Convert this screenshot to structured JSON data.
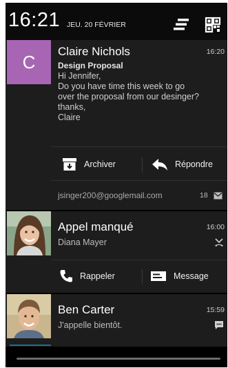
{
  "status_bar": {
    "time": "16:21",
    "date": "JEU. 20 FÉVRIER",
    "icons": [
      "notification-settings-icon",
      "quick-settings-icon"
    ]
  },
  "email_notification": {
    "avatar_letter": "C",
    "avatar_color": "#a865b4",
    "sender": "Claire Nichols",
    "time": "16:20",
    "subject": "Design Proposal",
    "body_lines": [
      "Hi Jennifer,",
      "Do you have time this week to go",
      "over the proposal from our desinger?",
      "thanks,",
      "Claire"
    ],
    "actions": [
      {
        "label": "Archiver",
        "icon": "archive-icon"
      },
      {
        "label": "Répondre",
        "icon": "reply-icon"
      }
    ],
    "account": "jsinger200@googlemail.com",
    "unread_count": "18",
    "account_icon": "mail-icon"
  },
  "missed_call_notification": {
    "avatar": "photo-woman",
    "title": "Appel manqué",
    "caller": "Diana Mayer",
    "time": "16:00",
    "status_icon": "missed-call-icon",
    "actions": [
      {
        "label": "Rappeler",
        "icon": "phone-icon"
      },
      {
        "label": "Message",
        "icon": "message-icon"
      }
    ]
  },
  "message_notification": {
    "avatar": "photo-man",
    "sender": "Ben Carter",
    "time": "15:59",
    "preview": "J'appelle bientôt.",
    "status_icon": "sms-icon"
  },
  "colors": {
    "background": "#000000",
    "card": "#1d1d1d",
    "accent_purple": "#a865b4",
    "accent_blue": "#1b6e8f"
  }
}
